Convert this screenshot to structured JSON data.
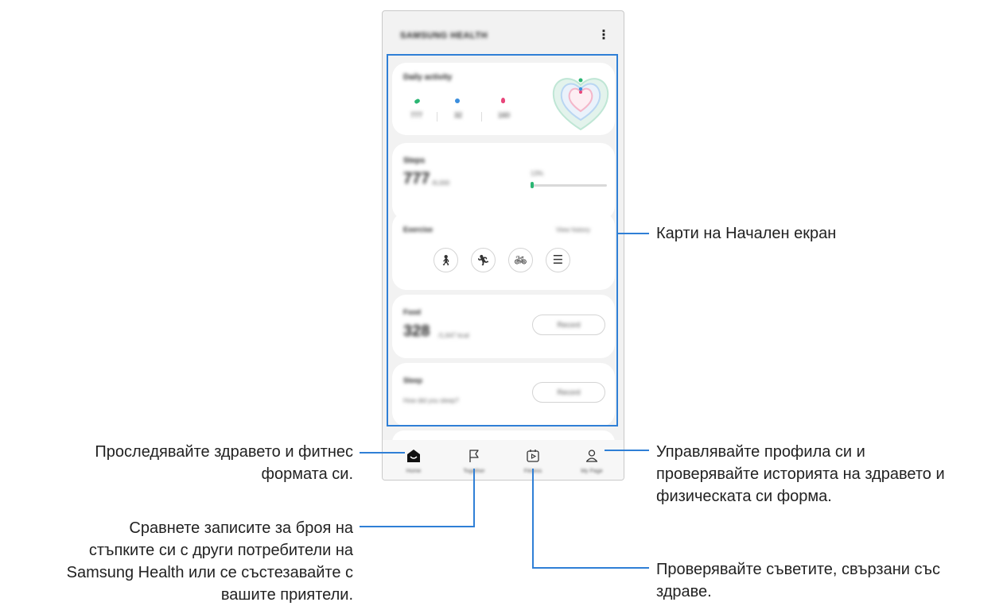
{
  "app": {
    "title": "Samsung Health",
    "more_icon": "more-vertical-icon"
  },
  "cards": {
    "daily_activity": {
      "title": "Daily activity",
      "stats": [
        "777",
        "32",
        "160"
      ]
    },
    "steps": {
      "title": "Steps",
      "value": "777",
      "goal": "/6,000",
      "percent_label": "13%",
      "progress": 0.13
    },
    "exercise": {
      "title": "Exercise",
      "link": "View history",
      "buttons": [
        "walking-icon",
        "running-icon",
        "cycling-icon",
        "list-icon"
      ]
    },
    "food": {
      "title": "Food",
      "value": "328",
      "unit": "/1,647 kcal",
      "button": "Record"
    },
    "sleep": {
      "title": "Sleep",
      "question": "How did you sleep?",
      "button": "Record"
    }
  },
  "nav": {
    "items": [
      {
        "label": "Home",
        "icon": "home-icon"
      },
      {
        "label": "Together",
        "icon": "flag-icon"
      },
      {
        "label": "Fitness",
        "icon": "fitness-video-icon"
      },
      {
        "label": "My Page",
        "icon": "person-icon"
      }
    ]
  },
  "callouts": {
    "home_cards": "Карти на Начален екран",
    "home_tab": [
      "Проследявайте здравето и фитнес",
      "формата си."
    ],
    "profile": [
      "Управлявайте профила си и",
      "проверявайте историята на здравето и",
      "физическата си форма."
    ],
    "together": [
      "Сравнете записите за броя на",
      "стъпките си с други потребители на",
      "Samsung Health или се състезавайте с",
      "вашите приятели."
    ],
    "fitness": [
      "Проверявайте съветите, свързани със",
      "здраве."
    ]
  },
  "colors": {
    "callout_line": "#2f7fd6",
    "steps_icon": "#2bb673",
    "active_time_icon": "#3b8ede",
    "calories_icon": "#e8457a",
    "progress": "#2bb673"
  }
}
